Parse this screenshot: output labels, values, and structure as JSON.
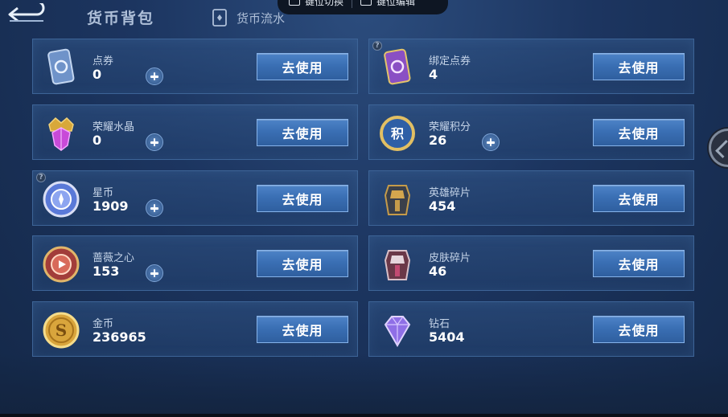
{
  "header": {
    "title": "货币背包",
    "flow_label": "货币流水"
  },
  "overlay": {
    "switch_label": "键位切换",
    "edit_label": "键位编辑"
  },
  "button_label": "去使用",
  "items": [
    {
      "name": "点券",
      "count": "0"
    },
    {
      "name": "绑定点券",
      "count": "4"
    },
    {
      "name": "荣耀水晶",
      "count": "0"
    },
    {
      "name": "荣耀积分",
      "count": "26"
    },
    {
      "name": "星币",
      "count": "1909"
    },
    {
      "name": "英雄碎片",
      "count": "454"
    },
    {
      "name": "蔷薇之心",
      "count": "153"
    },
    {
      "name": "皮肤碎片",
      "count": "46"
    },
    {
      "name": "金币",
      "count": "236965"
    },
    {
      "name": "钻石",
      "count": "5404"
    }
  ],
  "help_glyph": "?",
  "colors": {
    "button": "#3a6fb4",
    "card_border": "#3d6497",
    "background": "#1c3560"
  }
}
